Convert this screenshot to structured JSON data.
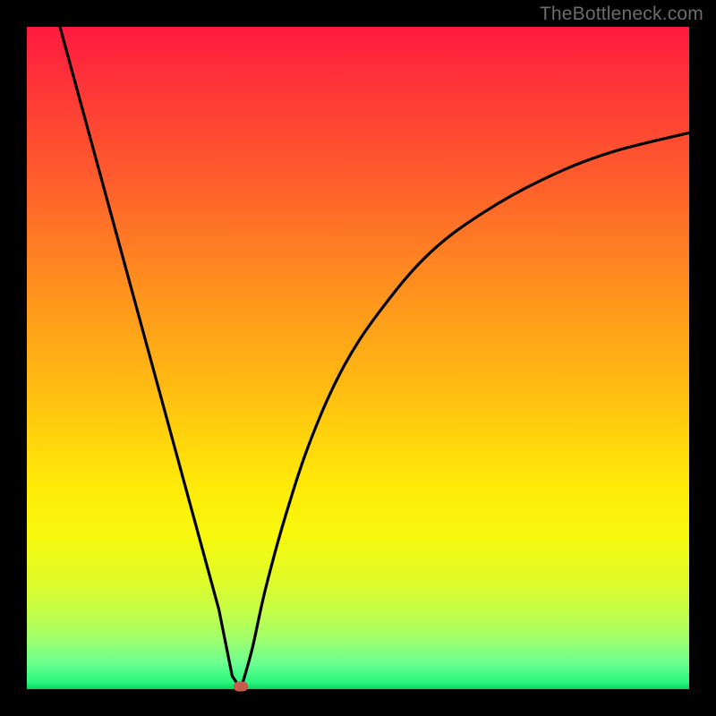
{
  "watermark": "TheBottleneck.com",
  "colors": {
    "frame": "#000000",
    "curve_stroke": "#000000",
    "marker": "#c95a4e",
    "gradient_top": "#ff1a3e",
    "gradient_bottom": "#0ad15a",
    "watermark_text": "#6c6c6c"
  },
  "chart_data": {
    "type": "line",
    "title": "",
    "xlabel": "",
    "ylabel": "",
    "xlim": [
      0,
      100
    ],
    "ylim": [
      0,
      100
    ],
    "grid": false,
    "legend": false,
    "series": [
      {
        "name": "left-branch",
        "x": [
          5,
          8,
          11,
          14,
          17,
          20,
          23,
          26,
          29,
          31,
          32.3
        ],
        "values": [
          100,
          89,
          78,
          67,
          56,
          45,
          34,
          23,
          12,
          2,
          0
        ]
      },
      {
        "name": "right-branch",
        "x": [
          32.3,
          34,
          36,
          39,
          43,
          48,
          54,
          61,
          69,
          78,
          88,
          100
        ],
        "values": [
          0,
          6,
          15,
          26,
          38,
          49,
          58,
          66,
          72,
          77,
          81,
          84
        ]
      }
    ],
    "annotations": [
      {
        "name": "minimum-marker",
        "x": 32.3,
        "y": 0
      }
    ]
  }
}
